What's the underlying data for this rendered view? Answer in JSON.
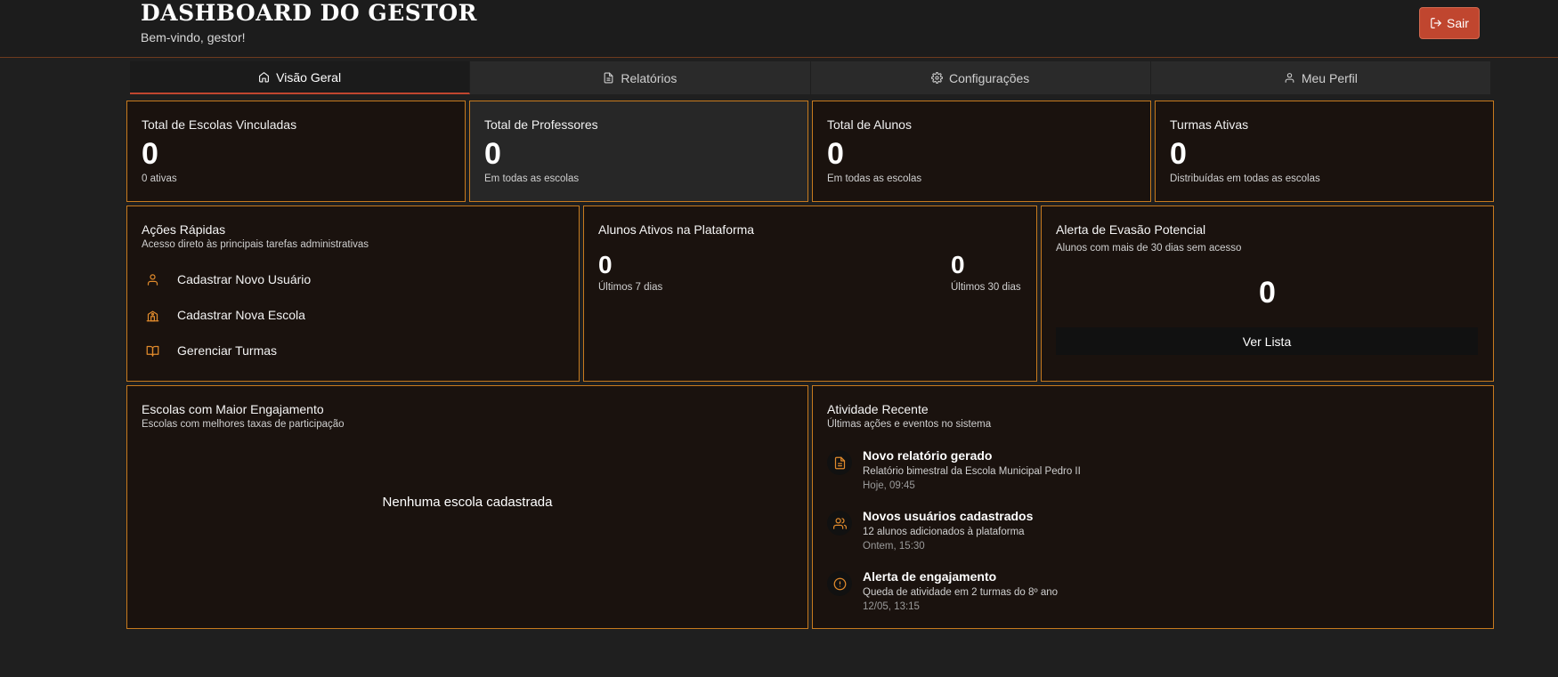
{
  "header": {
    "title": "DASHBOARD DO GESTOR",
    "subtitle": "Bem-vindo, gestor!",
    "logout_label": "Sair"
  },
  "tabs": [
    {
      "label": "Visão Geral",
      "icon": "home-icon",
      "active": true
    },
    {
      "label": "Relatórios",
      "icon": "document-icon",
      "active": false
    },
    {
      "label": "Configurações",
      "icon": "gear-icon",
      "active": false
    },
    {
      "label": "Meu Perfil",
      "icon": "user-icon",
      "active": false
    }
  ],
  "stats": [
    {
      "label": "Total de Escolas Vinculadas",
      "value": "0",
      "sub": "0 ativas"
    },
    {
      "label": "Total de Professores",
      "value": "0",
      "sub": "Em todas as escolas"
    },
    {
      "label": "Total de Alunos",
      "value": "0",
      "sub": "Em todas as escolas"
    },
    {
      "label": "Turmas Ativas",
      "value": "0",
      "sub": "Distribuídas em todas as escolas"
    }
  ],
  "quick_actions": {
    "title": "Ações Rápidas",
    "desc": "Acesso direto às principais tarefas administrativas",
    "items": [
      {
        "label": "Cadastrar Novo Usuário",
        "icon": "user-icon"
      },
      {
        "label": "Cadastrar Nova Escola",
        "icon": "school-icon"
      },
      {
        "label": "Gerenciar Turmas",
        "icon": "book-icon"
      }
    ]
  },
  "active_students": {
    "title": "Alunos Ativos na Plataforma",
    "last7_value": "0",
    "last7_label": "Últimos 7 dias",
    "last30_value": "0",
    "last30_label": "Últimos 30 dias"
  },
  "dropout_alert": {
    "title": "Alerta de Evasão Potencial",
    "desc": "Alunos com mais de 30 dias sem acesso",
    "value": "0",
    "button_label": "Ver Lista"
  },
  "top_schools": {
    "title": "Escolas com Maior Engajamento",
    "desc": "Escolas com melhores taxas de participação",
    "empty_text": "Nenhuma escola cadastrada"
  },
  "recent_activity": {
    "title": "Atividade Recente",
    "desc": "Últimas ações e eventos no sistema",
    "items": [
      {
        "title": "Novo relatório gerado",
        "desc": "Relatório bimestral da Escola Municipal Pedro II",
        "time": "Hoje, 09:45",
        "icon": "document-icon"
      },
      {
        "title": "Novos usuários cadastrados",
        "desc": "12 alunos adicionados à plataforma",
        "time": "Ontem, 15:30",
        "icon": "users-icon"
      },
      {
        "title": "Alerta de engajamento",
        "desc": "Queda de atividade em 2 turmas do 8º ano",
        "time": "12/05, 13:15",
        "icon": "alert-circle-icon"
      }
    ]
  },
  "colors": {
    "accent": "#c0462f",
    "border": "#c77a1e",
    "icon": "#e08a2c"
  }
}
